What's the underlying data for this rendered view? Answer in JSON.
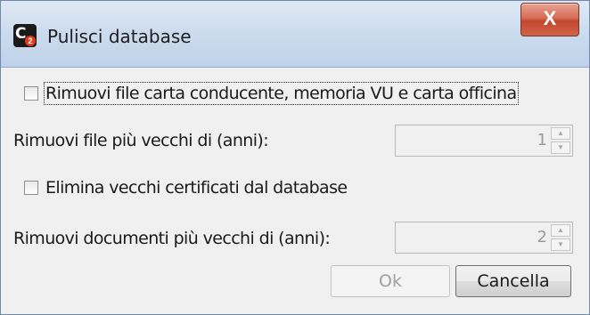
{
  "window": {
    "title": "Pulisci database",
    "icon": "app-logo-icon",
    "close_label": "X"
  },
  "options": {
    "remove_card_files_label": "Rimuovi file carta conducente, memoria VU e carta officina",
    "remove_card_files_checked": false,
    "remove_files_older_label": "Rimuovi file più vecchi di (anni):",
    "remove_files_older_value": "1",
    "delete_certificates_label": "Elimina vecchi certificati dal database",
    "delete_certificates_checked": false,
    "remove_documents_older_label": "Rimuovi documenti più vecchi di (anni):",
    "remove_documents_older_value": "2"
  },
  "buttons": {
    "ok_label": "Ok",
    "cancel_label": "Cancella"
  }
}
